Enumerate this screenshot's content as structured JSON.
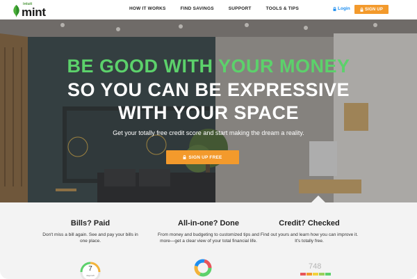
{
  "header": {
    "logo": {
      "brand_small": "intuit",
      "brand_name": "mint"
    },
    "nav": [
      {
        "label": "HOW IT WORKS"
      },
      {
        "label": "FIND SAVINGS"
      },
      {
        "label": "SUPPORT"
      },
      {
        "label": "TOOLS & TIPS"
      }
    ],
    "login_label": "Login",
    "signup_label": "SIGN UP"
  },
  "hero": {
    "line1": "BE GOOD WITH YOUR MONEY",
    "line2": "SO YOU CAN BE EXPRESSIVE",
    "line3": "WITH YOUR SPACE",
    "subtitle": "Get your totally free credit score and start making the dream a reality.",
    "cta_label": "SIGN UP FREE"
  },
  "features": [
    {
      "title": "Bills? Paid",
      "desc": "Don't miss a bill again. See and pay your bills in one place."
    },
    {
      "title": "All-in-one? Done",
      "desc": "From money and budgeting to customized tips and more—get a clear view of your total financial life."
    },
    {
      "title": "Credit? Checked",
      "desc": "Find out yours and learn how you can improve it. It's totally free."
    }
  ],
  "widgets": {
    "gauge_value": "7",
    "gauge_label": "days left",
    "credit_score": "748"
  },
  "colors": {
    "accent_orange": "#f39a2c",
    "accent_green": "#5cd16b",
    "link_blue": "#1d8ef0"
  }
}
